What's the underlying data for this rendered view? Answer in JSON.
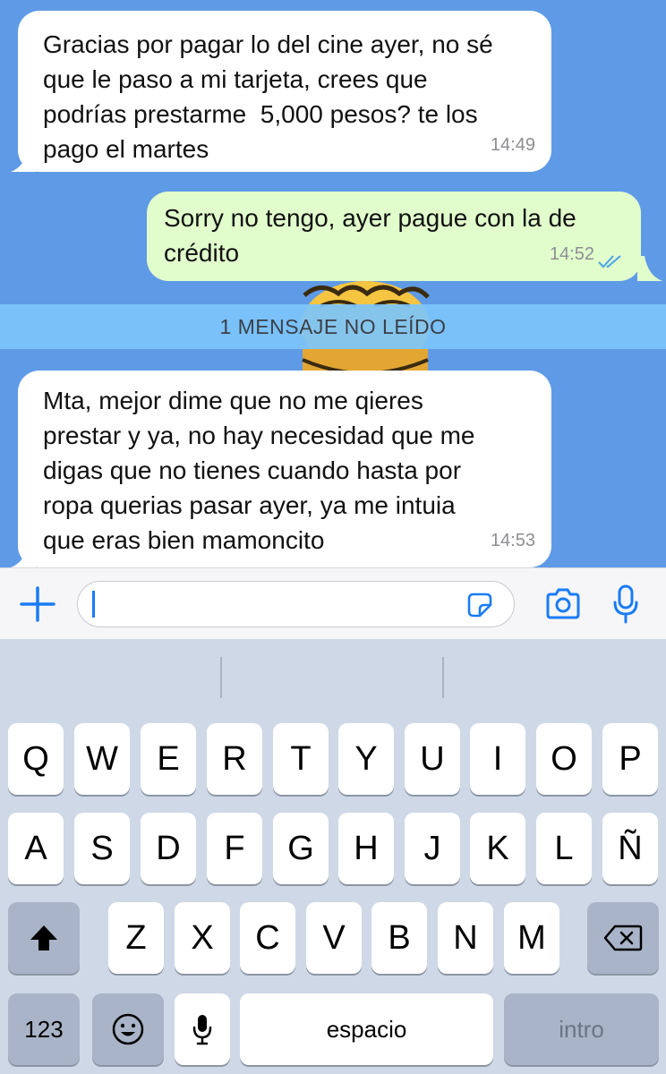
{
  "messages": [
    {
      "direction": "incoming",
      "lines": [
        "Gracias por pagar lo del cine ayer, no sé",
        "que le paso a mi tarjeta, crees que",
        "podrías prestarme  5,000 pesos? te los",
        "pago el martes"
      ],
      "time": "14:49"
    },
    {
      "direction": "outgoing",
      "lines": [
        "Sorry no tengo, ayer pague con la de",
        "crédito"
      ],
      "time": "14:52",
      "read_status": "double-check-read"
    },
    {
      "direction": "incoming",
      "lines": [
        "Mta, mejor dime que no me qieres",
        "prestar y ya, no hay necesidad que me",
        "digas que no tienes cuando hasta por",
        "ropa querias pasar ayer, ya me intuia",
        "que eras bien mamoncito"
      ],
      "time": "14:53"
    }
  ],
  "unread_banner": "1 MENSAJE NO LEÍDO",
  "input": {
    "value": "",
    "icons": [
      "plus-icon",
      "sticker-icon",
      "camera-icon",
      "microphone-icon"
    ]
  },
  "keyboard": {
    "row1": [
      "Q",
      "W",
      "E",
      "R",
      "T",
      "Y",
      "U",
      "I",
      "O",
      "P"
    ],
    "row2": [
      "A",
      "S",
      "D",
      "F",
      "G",
      "H",
      "J",
      "K",
      "L",
      "Ñ"
    ],
    "row3": [
      "Z",
      "X",
      "C",
      "V",
      "B",
      "N",
      "M"
    ],
    "numbers_label": "123",
    "space_label": "espacio",
    "return_label": "intro"
  },
  "colors": {
    "chat_bg": "#5f9ae6",
    "outgoing_bubble": "#e1fdcc",
    "incoming_bubble": "#ffffff",
    "accent": "#1a7cf5",
    "banner": "#7cc4fa"
  }
}
